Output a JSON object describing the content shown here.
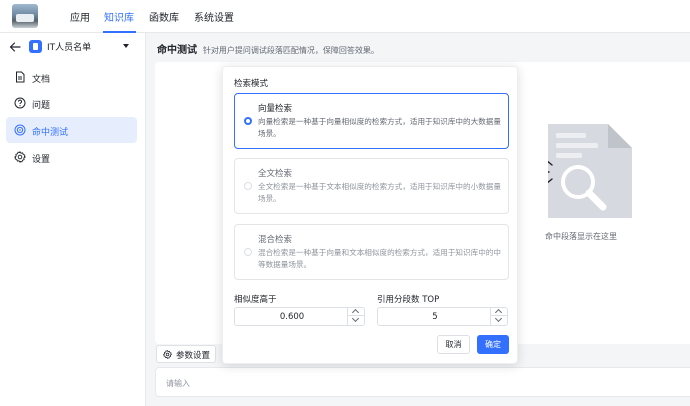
{
  "topnav": {
    "tabs": [
      {
        "label": "应用",
        "active": false
      },
      {
        "label": "知识库",
        "active": true
      },
      {
        "label": "函数库",
        "active": false
      },
      {
        "label": "系统设置",
        "active": false
      }
    ],
    "accent_color": "#3370ff"
  },
  "sidebar": {
    "kb_title": "IT人员名单",
    "items": [
      {
        "label": "文档",
        "icon": "document-icon",
        "active": false
      },
      {
        "label": "问题",
        "icon": "question-circle-icon",
        "active": false
      },
      {
        "label": "命中测试",
        "icon": "target-icon",
        "active": true
      },
      {
        "label": "设置",
        "icon": "gear-icon",
        "active": false
      }
    ]
  },
  "main": {
    "title": "命中测试",
    "description": "针对用户提问调试段落匹配情况，保障回答效果。",
    "empty_text": "命中段落显示在这里",
    "param_button": "参数设置",
    "input_placeholder": "请输入"
  },
  "popover": {
    "mode_label": "检索模式",
    "modes": [
      {
        "title": "向量检索",
        "desc": "向量检索是一种基于向量相似度的检索方式，适用于知识库中的大数据量场景。",
        "selected": true
      },
      {
        "title": "全文检索",
        "desc": "全文检索是一种基于文本相似度的检索方式，适用于知识库中的小数据量场景。",
        "selected": false
      },
      {
        "title": "混合检索",
        "desc": "混合检索是一种基于向量和文本相似度的检索方式，适用于知识库中的中等数据量场景。",
        "selected": false
      }
    ],
    "similarity_label": "相似度高于",
    "similarity_value": "0.600",
    "topn_label": "引用分段数 TOP",
    "topn_value": "5",
    "cancel_label": "取消",
    "confirm_label": "确定"
  }
}
